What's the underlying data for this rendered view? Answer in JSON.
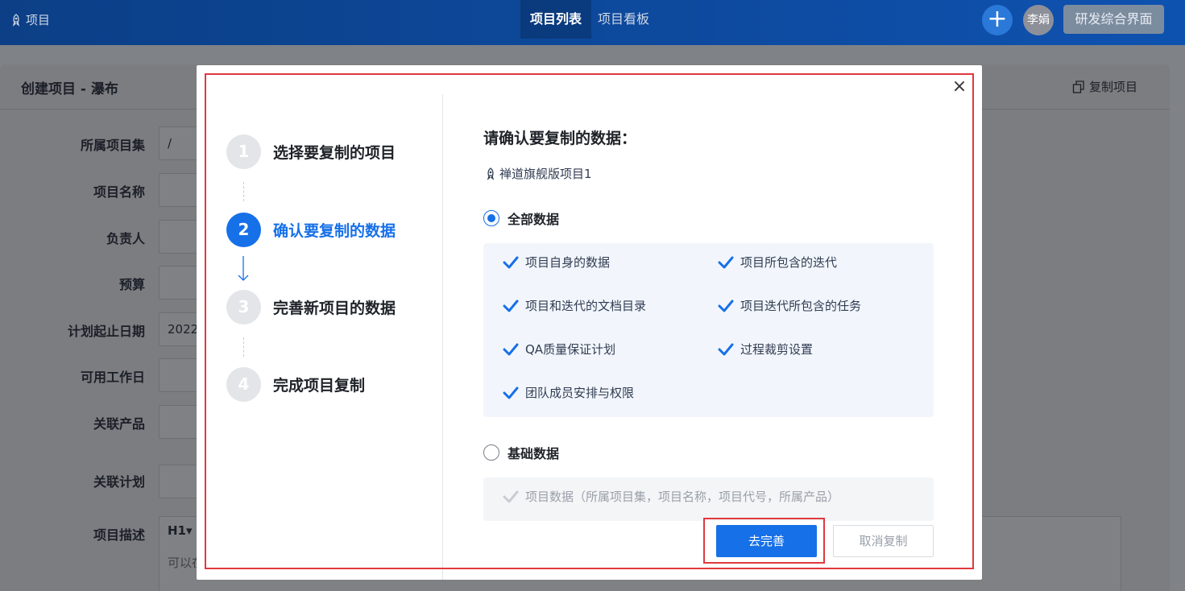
{
  "topbar": {
    "brand": "项目",
    "tabs": [
      "项目列表",
      "项目看板"
    ],
    "active_tab": 0,
    "avatar": "李娟",
    "rd_button": "研发综合界面"
  },
  "page": {
    "title": "创建项目 - 瀑布",
    "copy_project": "复制项目",
    "form": {
      "labels": [
        "所属项目集",
        "项目名称",
        "负责人",
        "预算",
        "计划起止日期",
        "可用工作日",
        "关联产品",
        "关联计划",
        "项目描述"
      ],
      "program_value": "/",
      "date_value": "2022",
      "editor_toolbar": "H1▾",
      "editor_placeholder": "可以在"
    }
  },
  "modal": {
    "close": "×",
    "steps": [
      {
        "num": "1",
        "label": "选择要复制的项目"
      },
      {
        "num": "2",
        "label": "确认要复制的数据"
      },
      {
        "num": "3",
        "label": "完善新项目的数据"
      },
      {
        "num": "4",
        "label": "完成项目复制"
      }
    ],
    "active_step": 1,
    "title": "请确认要复制的数据：",
    "project_name": "禅道旗舰版项目1",
    "all_data": {
      "label": "全部数据",
      "checked": true,
      "items": [
        "项目自身的数据",
        "项目所包含的迭代",
        "项目和迭代的文档目录",
        "项目迭代所包含的任务",
        "QA质量保证计划",
        "过程裁剪设置",
        "团队成员安排与权限"
      ]
    },
    "basic_data": {
      "label": "基础数据",
      "checked": false,
      "items": [
        "项目数据（所属项目集，项目名称，项目代号，所属产品）"
      ]
    },
    "buttons": {
      "primary": "去完善",
      "cancel": "取消复制"
    },
    "colors": {
      "primary": "#1670e8",
      "highlight": "#e0393e",
      "check": "#1670e8"
    }
  }
}
